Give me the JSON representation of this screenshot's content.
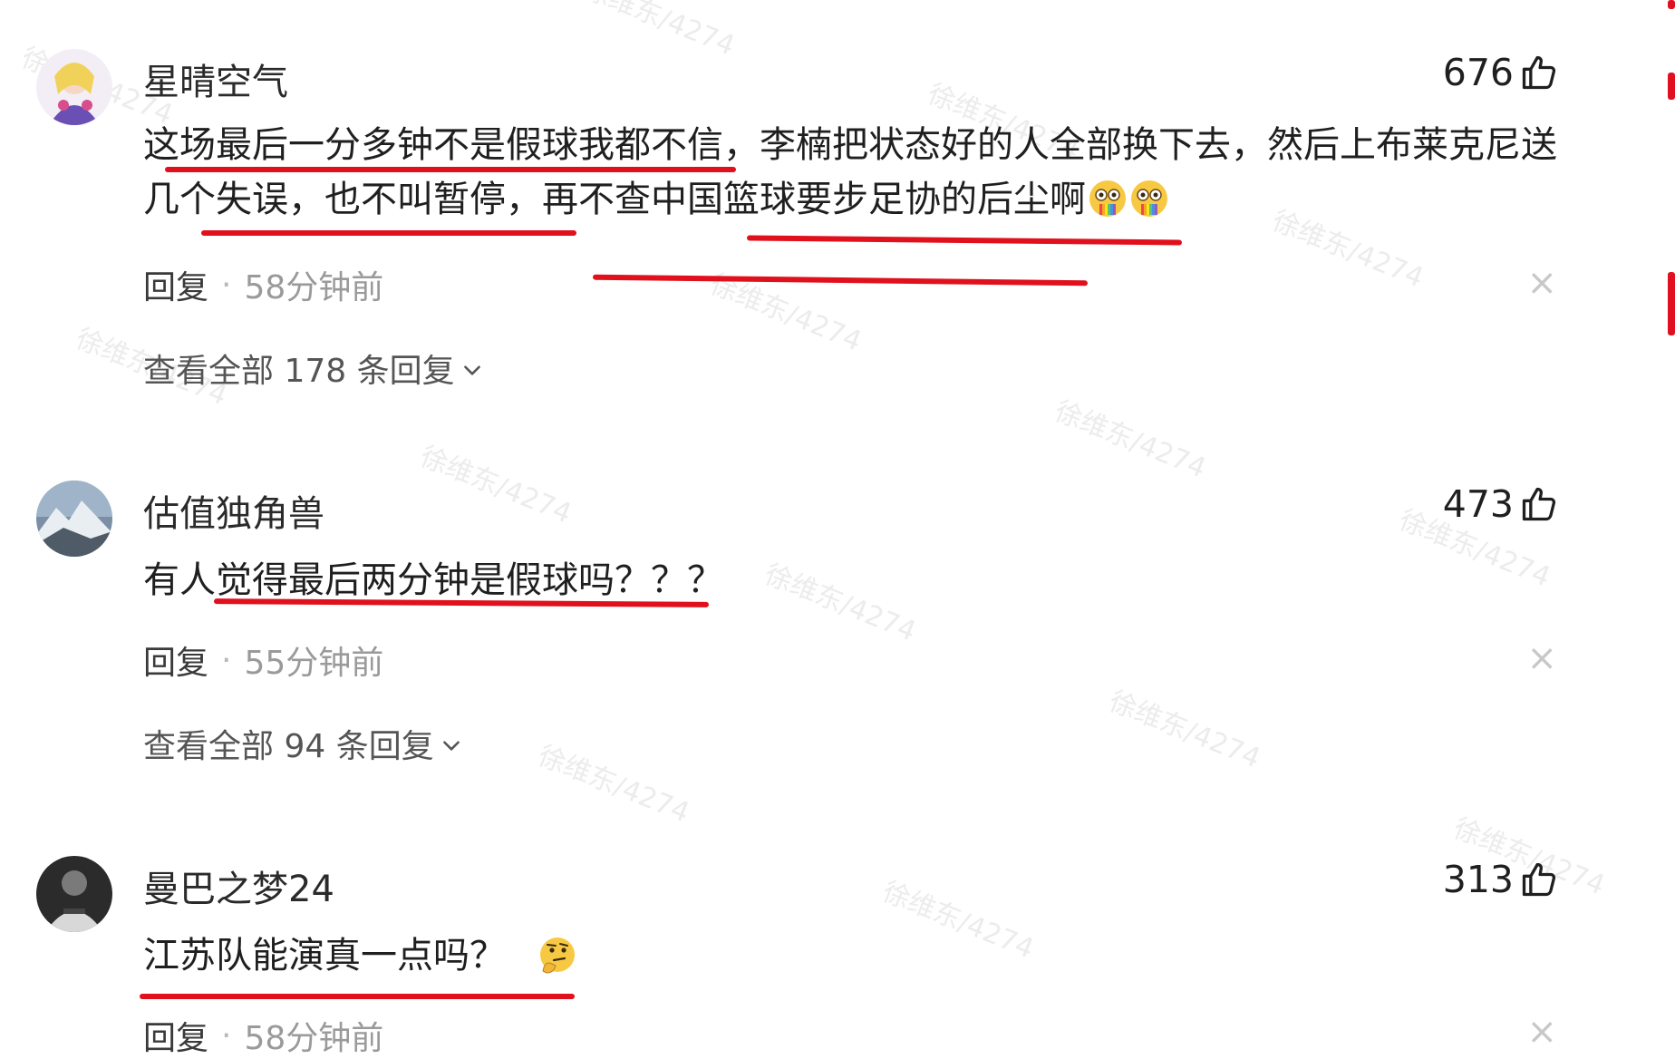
{
  "comments": [
    {
      "username": "星晴空气",
      "likes": "676",
      "text": "这场最后一分多钟不是假球我都不信，李楠把状态好的人全部换下去，然后上布莱克尼送几个失误，也不叫暂停，再不查中国篮球要步足协的后尘啊",
      "emoji": [
        "flushed-rainbow-emoji",
        "flushed-rainbow-emoji"
      ],
      "reply_label": "回复",
      "time": "58分钟前",
      "expand_label": "查看全部 178 条回复",
      "close_label": "×"
    },
    {
      "username": "估值独角兽",
      "likes": "473",
      "text": "有人觉得最后两分钟是假球吗？？？",
      "emoji": [],
      "reply_label": "回复",
      "time": "55分钟前",
      "expand_label": "查看全部 94 条回复",
      "close_label": "×"
    },
    {
      "username": "曼巴之梦24",
      "likes": "313",
      "text": "江苏队能演真一点吗？",
      "emoji": [
        "thinking-emoji"
      ],
      "reply_label": "回复",
      "time": "58分钟前",
      "close_label": "×"
    }
  ],
  "watermark": "徐维东/4274",
  "icons": {
    "like": "thumbs-up-icon",
    "expand": "chevron-down-icon",
    "close": "close-icon"
  },
  "colors": {
    "underline": "#e0101c",
    "time": "#9a9a9a",
    "text": "#1f1f1f"
  }
}
